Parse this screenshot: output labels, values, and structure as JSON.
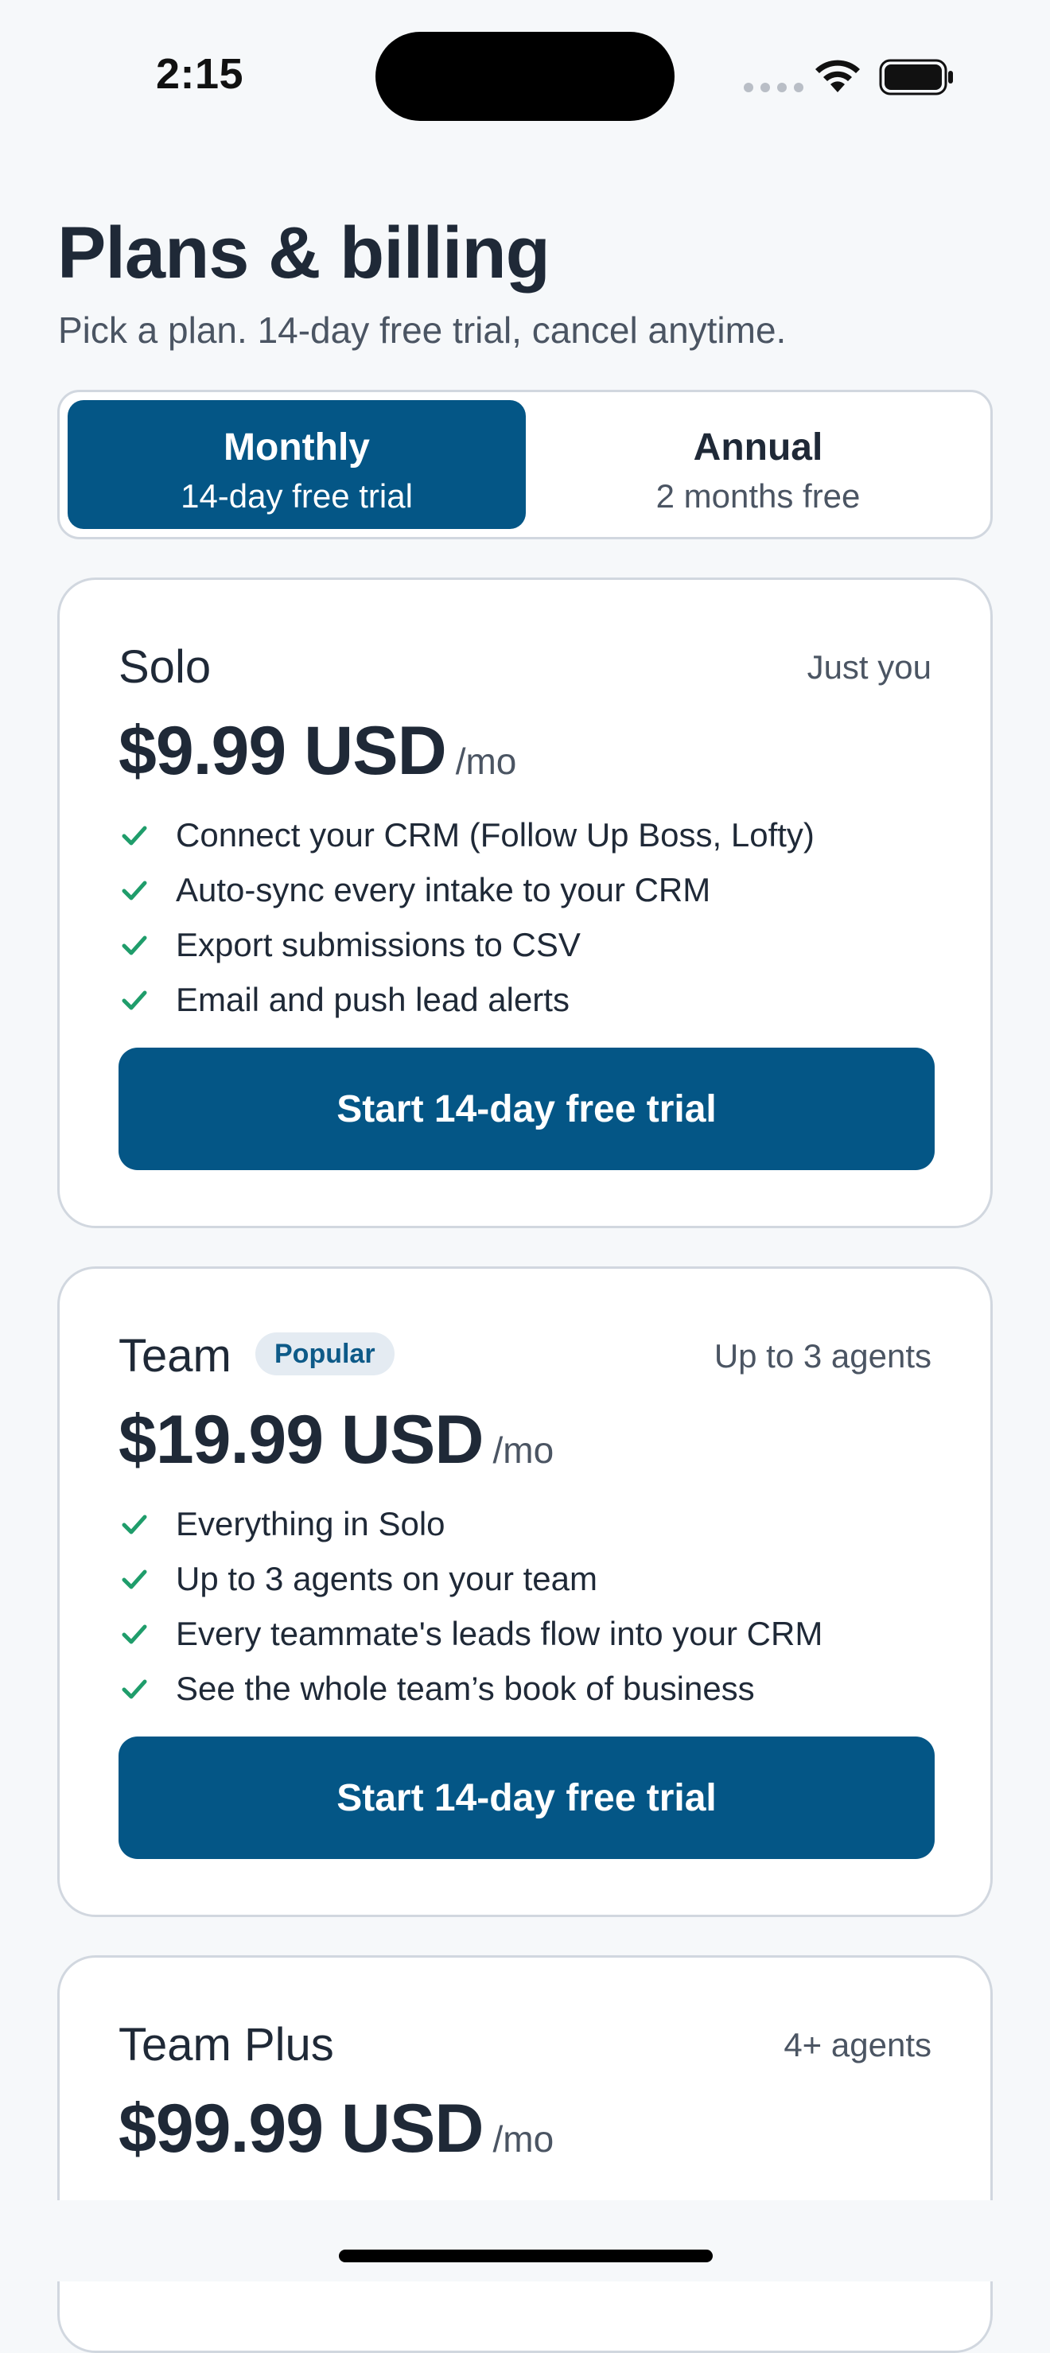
{
  "status_bar": {
    "time": "2:15",
    "icons": [
      "cellular-signal-icon",
      "wifi-icon",
      "battery-icon"
    ]
  },
  "header": {
    "title": "Plans & billing",
    "subtitle": "Pick a plan. 14-day free trial, cancel anytime."
  },
  "billing_toggle": {
    "selected": "monthly",
    "options": [
      {
        "title": "Monthly",
        "subtitle": "14-day free trial"
      },
      {
        "title": "Annual",
        "subtitle": "2 months free"
      }
    ]
  },
  "plans": [
    {
      "name": "Solo",
      "scope": "Just you",
      "price": "$9.99 USD",
      "period": "/mo",
      "features": [
        "Connect your CRM (Follow Up Boss, Lofty)",
        "Auto-sync every intake to your CRM",
        "Export submissions to CSV",
        "Email and push lead alerts"
      ],
      "cta": "Start 14-day free trial"
    },
    {
      "name": "Team",
      "badge": "Popular",
      "scope": "Up to 3 agents",
      "price": "$19.99 USD",
      "period": "/mo",
      "features": [
        "Everything in Solo",
        "Up to 3 agents on your team",
        "Every teammate's leads flow into your CRM",
        "See the whole team’s book of business"
      ],
      "cta": "Start 14-day free trial"
    },
    {
      "name": "Team Plus",
      "scope": "4+ agents",
      "price": "$99.99 USD",
      "period": "/mo"
    }
  ],
  "colors": {
    "primary": "#045686",
    "check": "#1f9d6b",
    "background": "#f6f8fa",
    "badge_bg": "#e4ebf2"
  }
}
